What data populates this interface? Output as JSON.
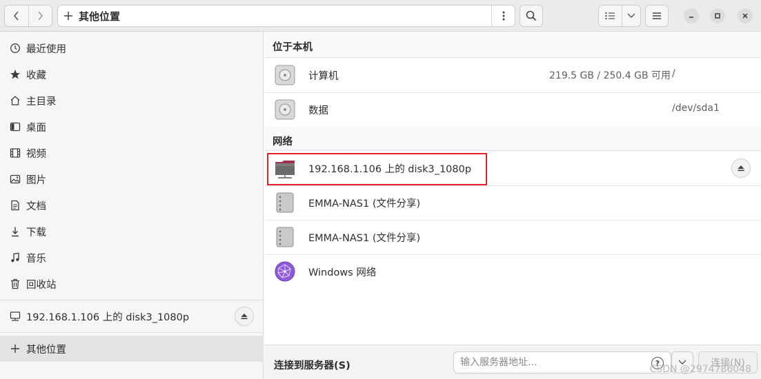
{
  "header": {
    "location": "其他位置",
    "back_icon": "chevron-left-icon",
    "forward_icon": "chevron-right-icon"
  },
  "sidebar": {
    "items": [
      {
        "label": "最近使用",
        "icon": "clock-icon"
      },
      {
        "label": "收藏",
        "icon": "star-icon"
      },
      {
        "label": "主目录",
        "icon": "home-icon"
      },
      {
        "label": "桌面",
        "icon": "desktop-icon"
      },
      {
        "label": "视频",
        "icon": "video-icon"
      },
      {
        "label": "图片",
        "icon": "image-icon"
      },
      {
        "label": "文档",
        "icon": "document-icon"
      },
      {
        "label": "下载",
        "icon": "download-icon"
      },
      {
        "label": "音乐",
        "icon": "music-icon"
      },
      {
        "label": "回收站",
        "icon": "trash-icon"
      }
    ],
    "mount": {
      "label": "192.168.1.106 上的 disk3_1080p"
    },
    "other": {
      "label": "其他位置"
    }
  },
  "main": {
    "local_section": {
      "title": "位于本机"
    },
    "local_items": [
      {
        "name": "计算机",
        "usage": "219.5 GB / 250.4 GB 可用",
        "path": "/"
      },
      {
        "name": "数据",
        "usage": "",
        "path": "/dev/sda1"
      }
    ],
    "network_section": {
      "title": "网络"
    },
    "network_items": [
      {
        "name": "192.168.1.106 上的 disk3_1080p"
      },
      {
        "name": "EMMA-NAS1 (文件分享)"
      },
      {
        "name": "EMMA-NAS1 (文件分享)"
      },
      {
        "name": "Windows 网络"
      }
    ]
  },
  "bottom": {
    "connect_label": "连接到服务器(S)",
    "server_placeholder": "输入服务器地址...",
    "help_text": "?",
    "connect_button": "连接(N)",
    "watermark": "CSDN @2974786048"
  },
  "colors": {
    "highlight": "#e0202a",
    "accent": "#8f5ad6"
  }
}
